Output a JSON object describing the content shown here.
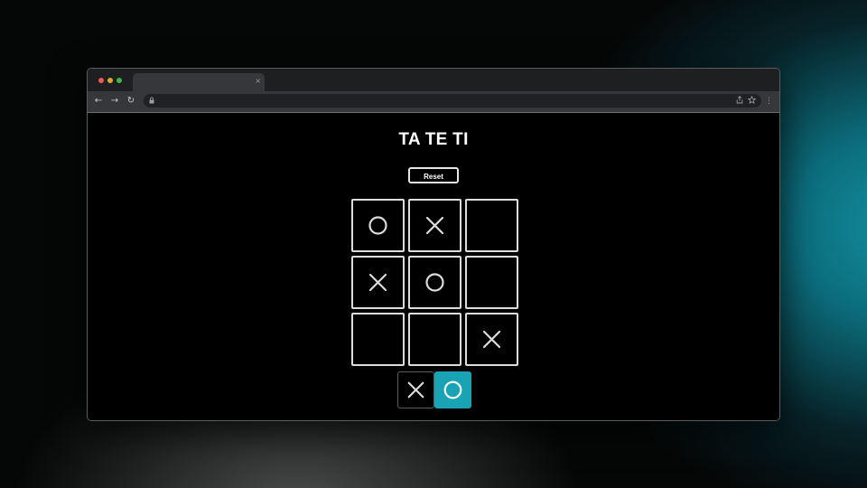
{
  "browser": {
    "tab_close": "×",
    "nav": {
      "back": "←",
      "forward": "→",
      "reload": "↻"
    },
    "address_icons": {
      "lock": "lock-icon",
      "share": "share-icon",
      "star": "star-icon"
    },
    "menu": "⋮"
  },
  "game": {
    "title": "TA TE TI",
    "reset_label": "Reset",
    "board": [
      [
        "O",
        "X",
        ""
      ],
      [
        "X",
        "O",
        ""
      ],
      [
        "",
        "",
        "X"
      ]
    ],
    "player_choice": {
      "options": [
        "X",
        "O"
      ],
      "selected": "O"
    }
  },
  "colors": {
    "accent": "#1aa3b4",
    "mark": "#dcdcdc",
    "cell_border": "#dcdcdc"
  }
}
